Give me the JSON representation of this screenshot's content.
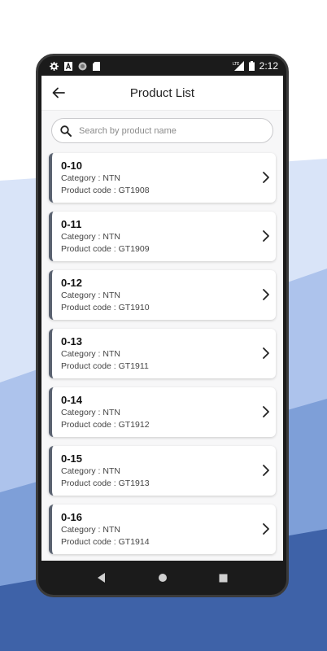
{
  "status_bar": {
    "time": "2:12",
    "network": "LTE"
  },
  "app_bar": {
    "title": "Product List",
    "back_icon": "arrow-left-icon"
  },
  "search": {
    "placeholder": "Search by product name",
    "value": ""
  },
  "products": [
    {
      "name": "0-10",
      "category": "Category : NTN",
      "code": "Product code : GT1908"
    },
    {
      "name": "0-11",
      "category": "Category : NTN",
      "code": "Product code : GT1909"
    },
    {
      "name": "0-12",
      "category": "Category : NTN",
      "code": "Product code : GT1910"
    },
    {
      "name": "0-13",
      "category": "Category : NTN",
      "code": "Product code : GT1911"
    },
    {
      "name": "0-14",
      "category": "Category : NTN",
      "code": "Product code : GT1912"
    },
    {
      "name": "0-15",
      "category": "Category : NTN",
      "code": "Product code : GT1913"
    },
    {
      "name": "0-16",
      "category": "Category : NTN",
      "code": "Product code : GT1914"
    }
  ],
  "colors": {
    "card_accent": "#5a6270",
    "bg_light_blue": "#d9e4f8",
    "bg_mid_blue": "#7e9fd8",
    "bg_dark_blue": "#3e62a8"
  }
}
